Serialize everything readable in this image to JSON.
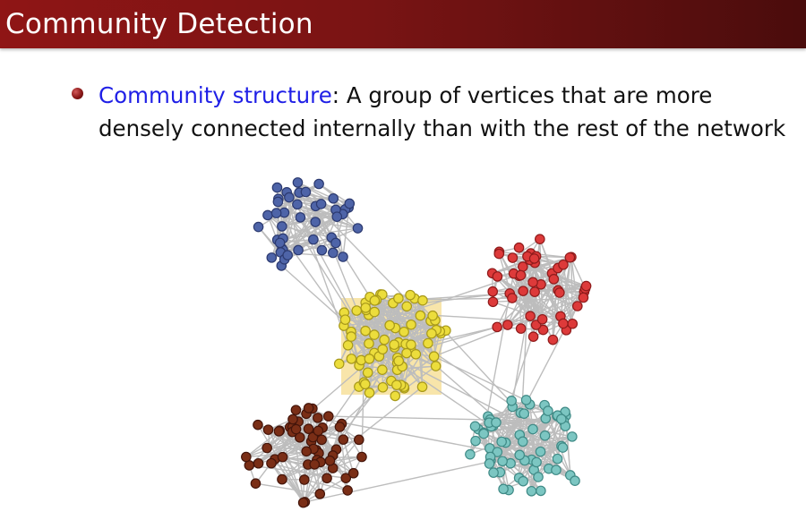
{
  "slide": {
    "title": "Community Detection",
    "bullet": {
      "term": "Community structure",
      "separator": ":",
      "line1": " A group of vertices that are more",
      "line2": "densely connected internally than with the rest of the network"
    }
  },
  "figure": {
    "highlight_color": "#f6dc8e",
    "edge_color": "#bdbdbd",
    "communities": [
      {
        "name": "blue",
        "fill": "#4e64a8",
        "stroke": "#2c3a70"
      },
      {
        "name": "red",
        "fill": "#dd3a3a",
        "stroke": "#8f1b1b"
      },
      {
        "name": "yellow",
        "fill": "#ecdd3c",
        "stroke": "#a8991a"
      },
      {
        "name": "brown",
        "fill": "#7a2e16",
        "stroke": "#44150a"
      },
      {
        "name": "teal",
        "fill": "#7cc6c2",
        "stroke": "#3f8a86"
      }
    ]
  }
}
